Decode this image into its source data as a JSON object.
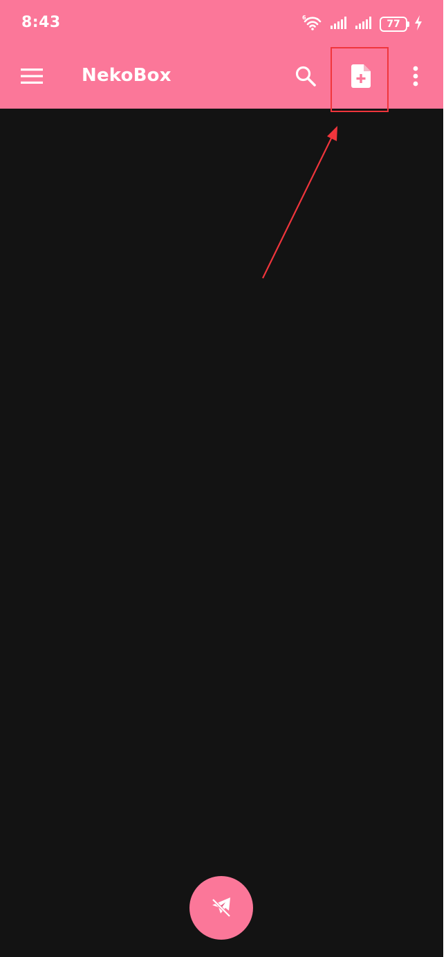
{
  "status_bar": {
    "time": "8:43",
    "battery_level": "77",
    "icons": [
      "wifi-6-icon",
      "signal-bars-icon",
      "signal-bars-icon",
      "battery-icon",
      "charging-bolt-icon"
    ]
  },
  "app_bar": {
    "title": "NekoBox",
    "background_color": "#fb7799",
    "actions": [
      {
        "name": "menu-icon"
      },
      {
        "name": "search-icon"
      },
      {
        "name": "add-file-icon"
      },
      {
        "name": "more-vertical-icon"
      }
    ]
  },
  "content": {
    "background_color": "#131313"
  },
  "fab": {
    "icon": "airplane-off-icon",
    "color": "#fb7799"
  },
  "annotation": {
    "highlight_color": "#f0353c",
    "arrow_color": "#f0353c"
  }
}
